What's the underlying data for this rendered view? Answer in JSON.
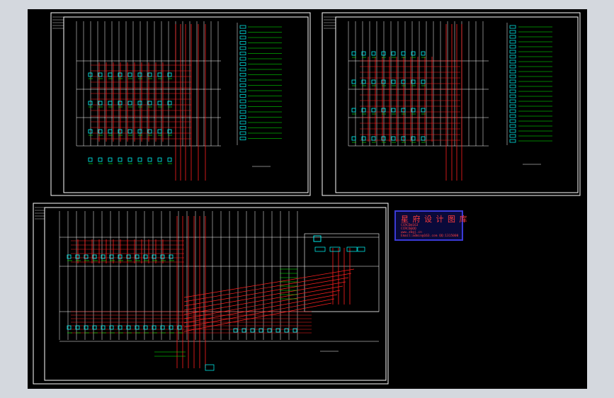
{
  "logo": {
    "title": "星 府 设 计 图 库",
    "lines": [
      "CCRCD@163",
      "CCRCD@QQ",
      "www.zbgj.cn",
      "Email:admin@163.com QQ:1315000"
    ]
  },
  "colors": {
    "background": "#000000",
    "border": "#ffffff",
    "wire": "#ff2020",
    "device": "#00ffff",
    "label": "#00ff00",
    "workspace": "#d4d8de",
    "logo_border": "#3a3ad6",
    "logo_text": "#ff3b3b"
  }
}
